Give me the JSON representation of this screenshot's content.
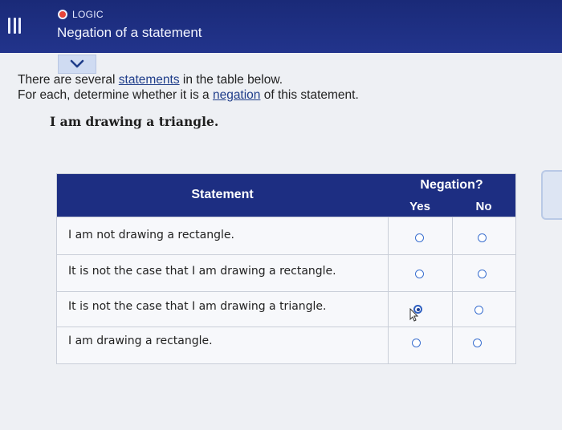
{
  "header": {
    "topic": "LOGIC",
    "title": "Negation of a statement"
  },
  "instructions": {
    "line1_before": "There are several",
    "line1_link": "statements",
    "line1_after": "in the table below.",
    "line2_before": "For each, determine whether it is a",
    "line2_link": "negation",
    "line2_after": "of this statement."
  },
  "given_statement": "I am drawing a triangle.",
  "table": {
    "header_statement": "Statement",
    "header_negation": "Negation?",
    "header_yes": "Yes",
    "header_no": "No",
    "rows": [
      {
        "statement": "I am not drawing a rectangle.",
        "selected": null
      },
      {
        "statement": "It is not the case that I am drawing a rectangle.",
        "selected": null
      },
      {
        "statement": "It is not the case that I am drawing a triangle.",
        "selected": "Yes"
      },
      {
        "statement": "I am drawing a rectangle.",
        "selected": null
      }
    ]
  },
  "colors": {
    "header_bg": "#1a2a78",
    "table_header_bg": "#1d2e82",
    "radio_accent": "#3a6fcf",
    "topic_dot": "#e7453a"
  },
  "icons": [
    "menu-icon",
    "chevron-down-icon",
    "pointer-cursor-icon"
  ]
}
